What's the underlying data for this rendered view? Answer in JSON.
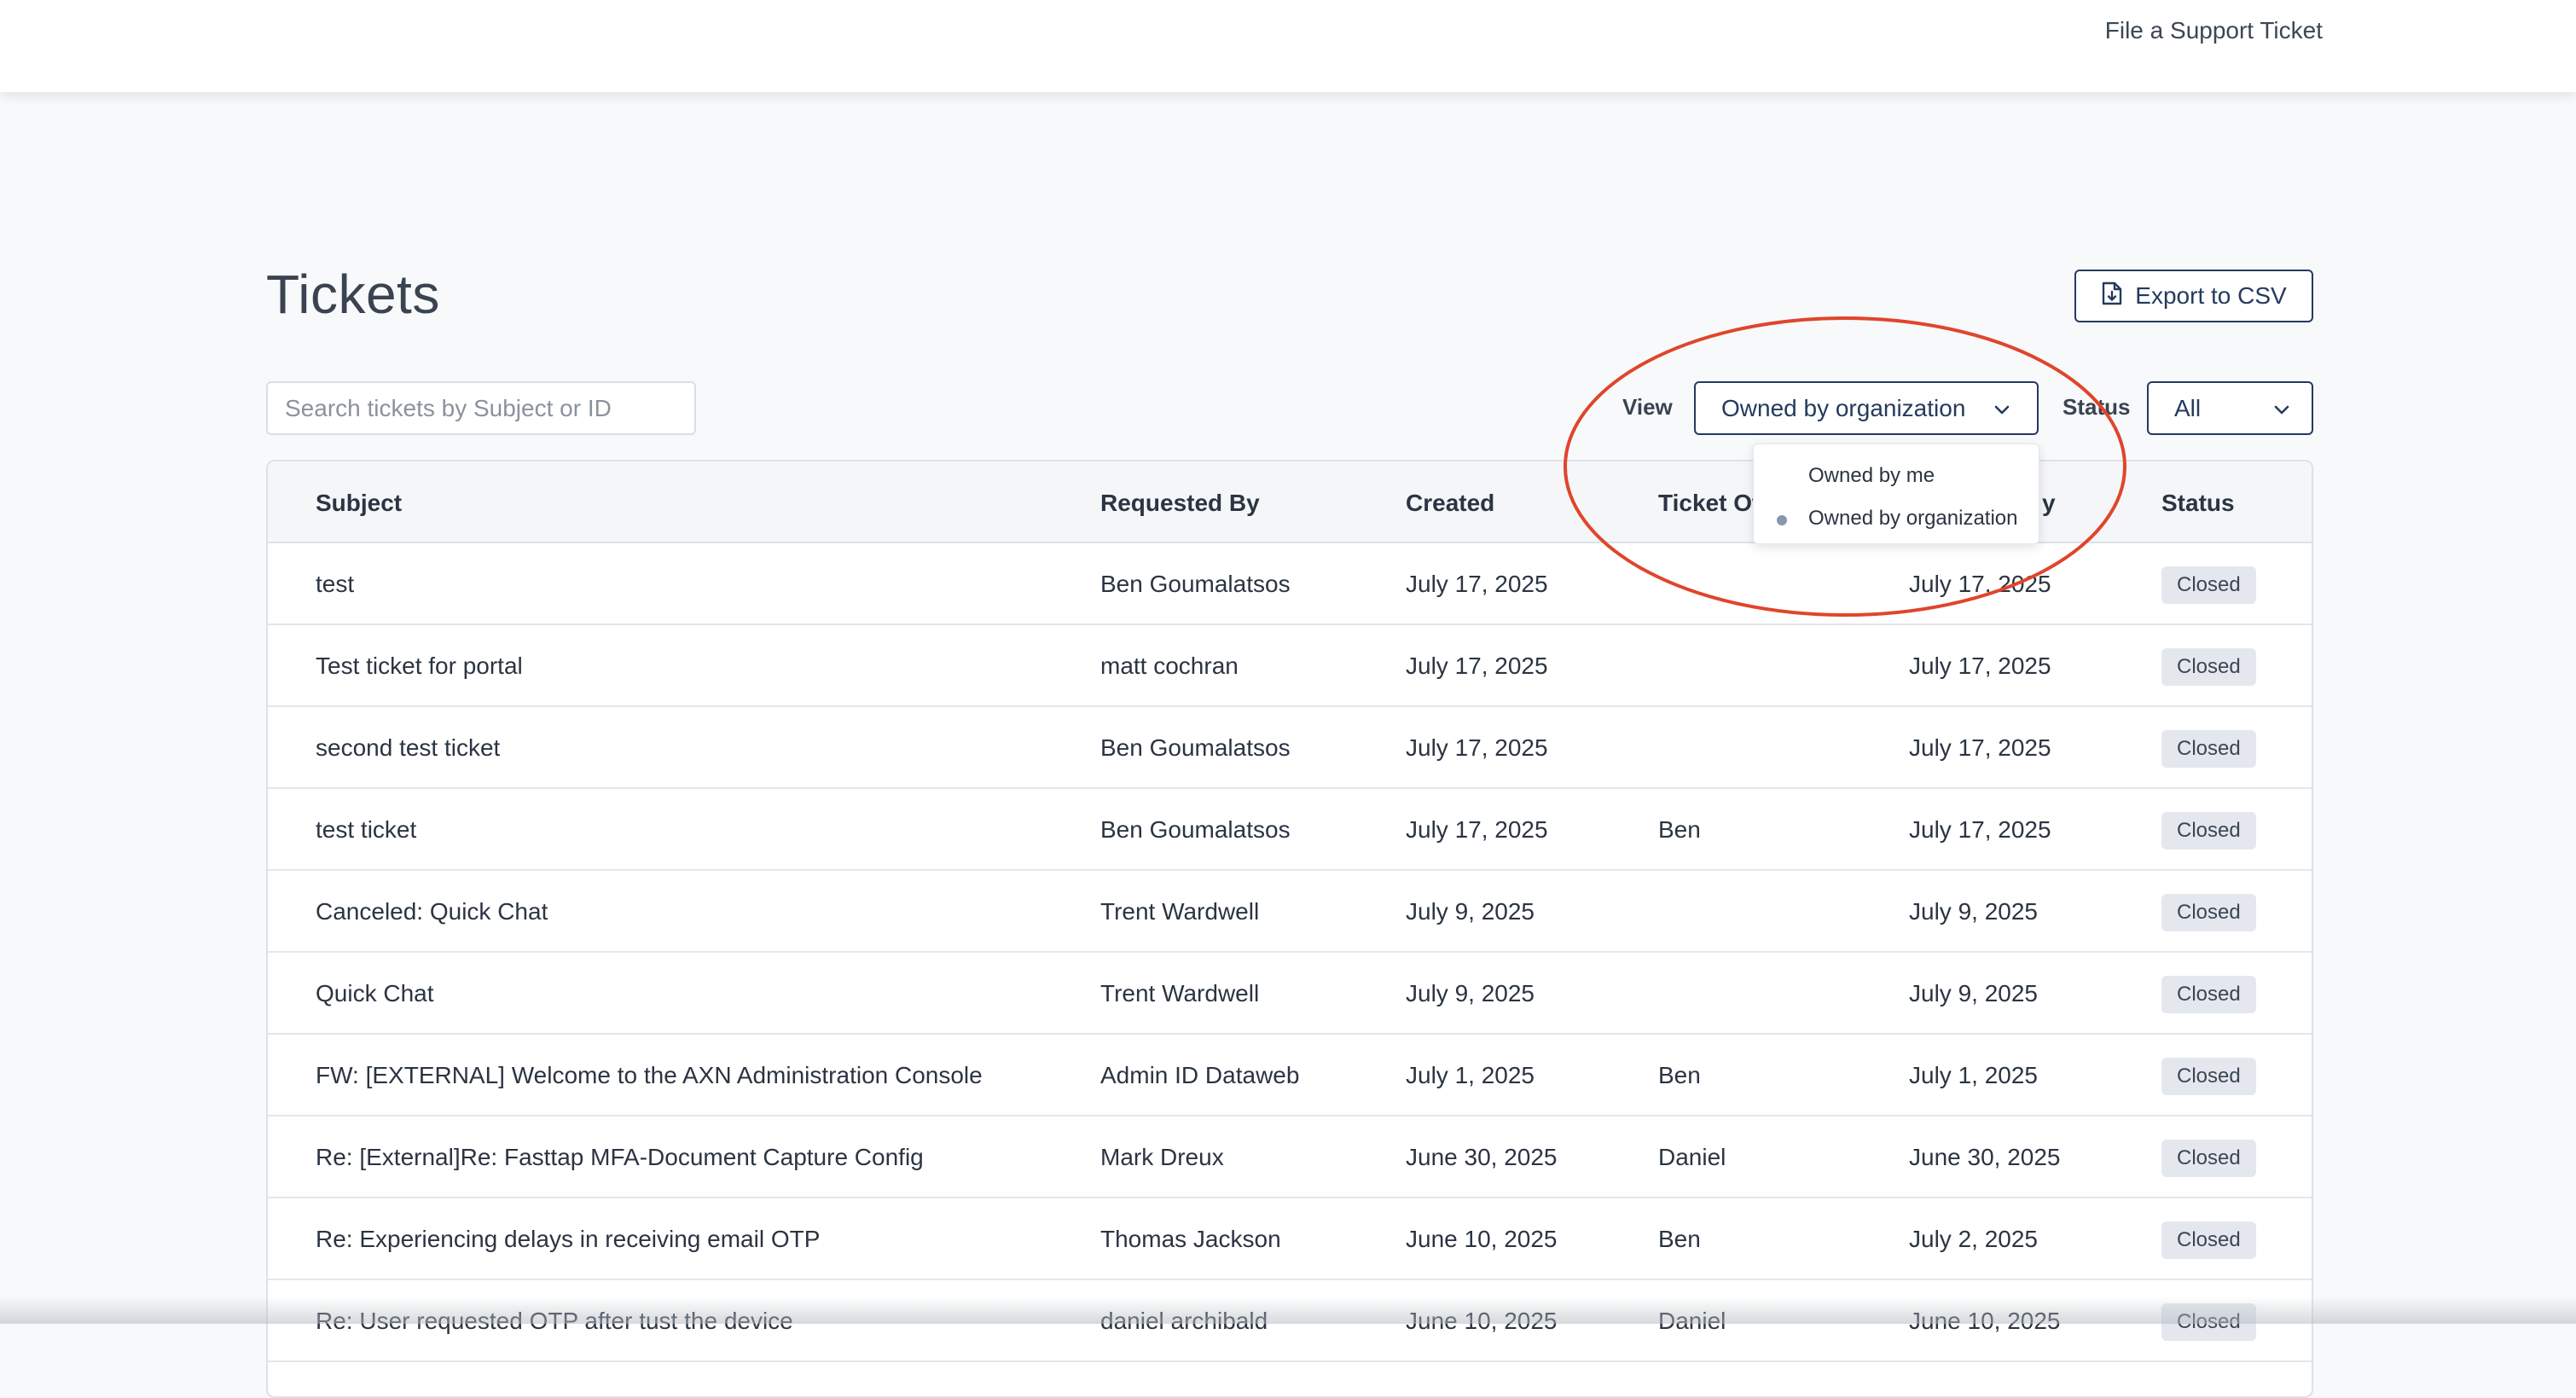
{
  "header": {
    "support_link": "File a Support Ticket"
  },
  "page": {
    "title": "Tickets",
    "export_label": "Export to CSV"
  },
  "search": {
    "placeholder": "Search tickets by Subject or ID"
  },
  "filters": {
    "view_label": "View",
    "view_value": "Owned by organization",
    "status_label": "Status",
    "status_value": "All",
    "view_options": [
      {
        "label": "Owned by me",
        "selected": false
      },
      {
        "label": "Owned by organization",
        "selected": true
      }
    ]
  },
  "table": {
    "columns": {
      "subject": "Subject",
      "requested_by": "Requested By",
      "created": "Created",
      "owner": "Ticket Ow",
      "updated": "y",
      "status": "Status"
    },
    "rows": [
      {
        "subject": "test",
        "requested_by": "Ben Goumalatsos",
        "created": "July 17, 2025",
        "owner": "",
        "updated": "July 17, 2025",
        "status": "Closed"
      },
      {
        "subject": "Test ticket for portal",
        "requested_by": "matt cochran",
        "created": "July 17, 2025",
        "owner": "",
        "updated": "July 17, 2025",
        "status": "Closed"
      },
      {
        "subject": "second test ticket",
        "requested_by": "Ben Goumalatsos",
        "created": "July 17, 2025",
        "owner": "",
        "updated": "July 17, 2025",
        "status": "Closed"
      },
      {
        "subject": "test ticket",
        "requested_by": "Ben Goumalatsos",
        "created": "July 17, 2025",
        "owner": "Ben",
        "updated": "July 17, 2025",
        "status": "Closed"
      },
      {
        "subject": "Canceled: Quick Chat",
        "requested_by": "Trent Wardwell",
        "created": "July 9, 2025",
        "owner": "",
        "updated": "July 9, 2025",
        "status": "Closed"
      },
      {
        "subject": "Quick Chat",
        "requested_by": "Trent Wardwell",
        "created": "July 9, 2025",
        "owner": "",
        "updated": "July 9, 2025",
        "status": "Closed"
      },
      {
        "subject": "FW: [EXTERNAL] Welcome to the AXN Administration Console",
        "requested_by": "Admin ID Dataweb",
        "created": "July 1, 2025",
        "owner": "Ben",
        "updated": "July 1, 2025",
        "status": "Closed"
      },
      {
        "subject": "Re: [External]Re: Fasttap MFA-Document Capture Config",
        "requested_by": "Mark Dreux",
        "created": "June 30, 2025",
        "owner": "Daniel",
        "updated": "June 30, 2025",
        "status": "Closed"
      },
      {
        "subject": "Re: Experiencing delays in receiving email OTP",
        "requested_by": "Thomas Jackson",
        "created": "June 10, 2025",
        "owner": "Ben",
        "updated": "July 2, 2025",
        "status": "Closed"
      },
      {
        "subject": "Re: User requested OTP after tust the device",
        "requested_by": "daniel archibald",
        "created": "June 10, 2025",
        "owner": "Daniel",
        "updated": "June 10, 2025",
        "status": "Closed"
      }
    ]
  },
  "colors": {
    "accent": "#243a5e",
    "annotation": "#e0452b",
    "badge_bg": "#e4e8ee"
  }
}
